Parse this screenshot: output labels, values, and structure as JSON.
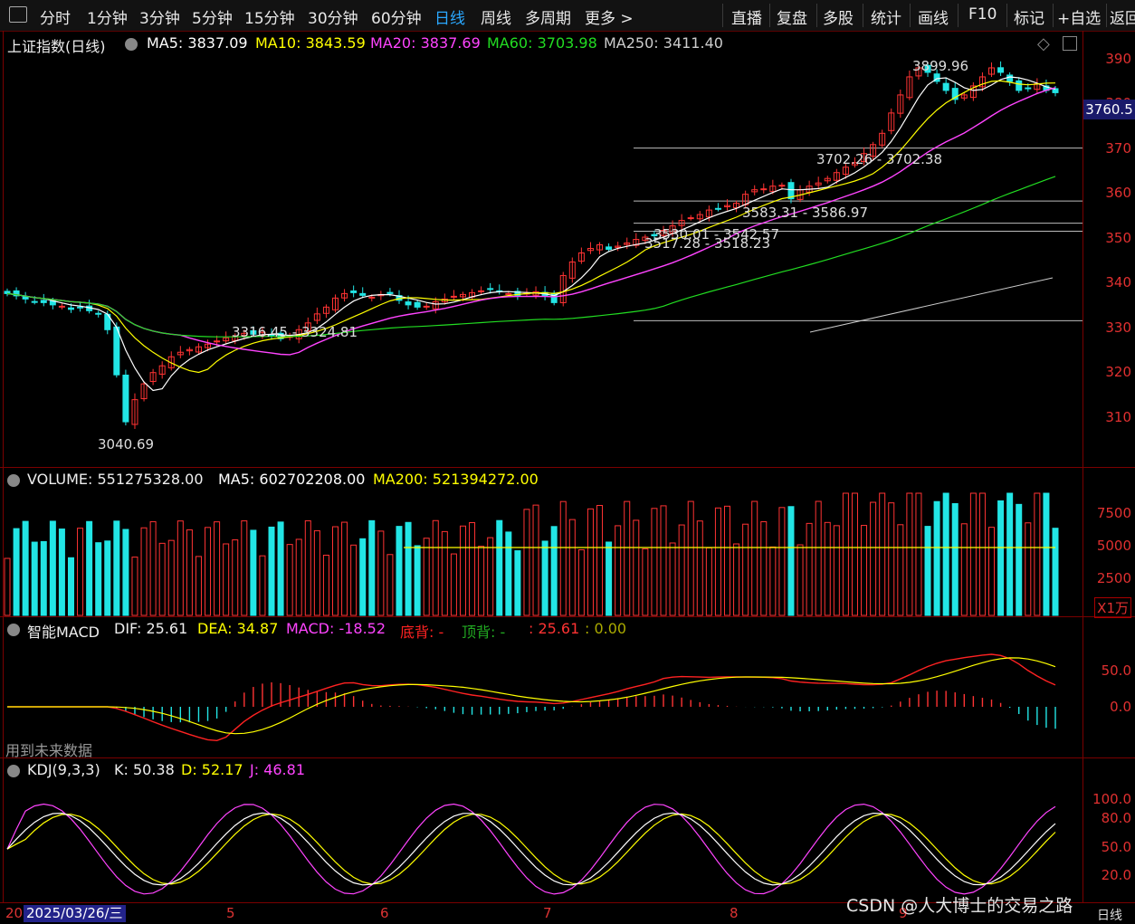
{
  "toolbar": {
    "periods": [
      "分时",
      "1分钟",
      "3分钟",
      "5分钟",
      "15分钟",
      "30分钟",
      "60分钟",
      "日线",
      "周线",
      "多周期",
      "更多 >"
    ],
    "active_period": "日线",
    "actions": [
      "直播",
      "复盘",
      "多股",
      "统计",
      "画线",
      "F10",
      "标记",
      "+自选",
      "返回"
    ]
  },
  "main": {
    "title": "上证指数(日线)",
    "ma": [
      {
        "label": "MA5: 3837.09",
        "color": "#ffffff"
      },
      {
        "label": "MA10: 3843.59",
        "color": "#ffff00"
      },
      {
        "label": "MA20: 3837.69",
        "color": "#ff44ff"
      },
      {
        "label": "MA60: 3703.98",
        "color": "#22dd22"
      },
      {
        "label": "MA250: 3411.40",
        "color": "#cccccc"
      }
    ],
    "last_price": "3760.5",
    "y_ticks": [
      "390",
      "380",
      "370",
      "360",
      "350",
      "340",
      "330",
      "320",
      "310"
    ],
    "annotations": [
      "3899.96",
      "3702.26 - 3702.38",
      "3583.31 - 3586.97",
      "3530.01 - 3542.57",
      "3517.28 - 3518.23",
      "3316.45 - 3324.81",
      "3040.69"
    ]
  },
  "volume": {
    "header": "VOLUME: 551275328.00",
    "ma5": "MA5: 602702208.00",
    "ma200": "MA200: 521394272.00",
    "y_ticks": [
      "7500",
      "5000",
      "2500"
    ],
    "unit": "X1万"
  },
  "macd": {
    "name": "智能MACD",
    "dif": "DIF: 25.61",
    "dea": "DEA: 34.87",
    "macd": "MACD: -18.52",
    "bottom_div": "底背: -",
    "top_div": "顶背: -",
    "v1": ": 25.61",
    "v2": ": 0.00",
    "y_ticks": [
      "50.0",
      "0.0"
    ],
    "note": "用到未来数据"
  },
  "kdj": {
    "name": "KDJ(9,3,3)",
    "k": "K: 50.38",
    "d": "D: 52.17",
    "j": "J: 46.81",
    "y_ticks": [
      "100.0",
      "80.0",
      "50.0",
      "20.0"
    ]
  },
  "datebar": {
    "current": "2025/03/26/三",
    "prefix": "20",
    "months": [
      "5",
      "6",
      "7",
      "8",
      "9"
    ],
    "period_label": "日线"
  },
  "watermark": "CSDN @人大博士的交易之路",
  "chart_data": {
    "type": "candlestick",
    "title": "上证指数(日线)",
    "ylim": [
      3000,
      3930
    ],
    "points": 116,
    "price_high_low_marks": {
      "high": 3899.96,
      "low": 3040.69
    },
    "close_approx": [
      3380,
      3375,
      3368,
      3362,
      3360,
      3355,
      3352,
      3345,
      3350,
      3342,
      3335,
      3300,
      3200,
      3096,
      3145,
      3180,
      3205,
      3220,
      3240,
      3250,
      3256,
      3262,
      3268,
      3275,
      3282,
      3286,
      3292,
      3290,
      3294,
      3288,
      3280,
      3285,
      3300,
      3315,
      3335,
      3350,
      3370,
      3380,
      3382,
      3376,
      3372,
      3378,
      3380,
      3365,
      3355,
      3350,
      3352,
      3362,
      3368,
      3374,
      3378,
      3382,
      3386,
      3390,
      3384,
      3380,
      3376,
      3382,
      3384,
      3375,
      3360,
      3420,
      3450,
      3470,
      3480,
      3488,
      3478,
      3485,
      3492,
      3500,
      3505,
      3508,
      3520,
      3530,
      3542,
      3548,
      3555,
      3565,
      3568,
      3575,
      3580,
      3600,
      3610,
      3612,
      3618,
      3620,
      3590,
      3610,
      3618,
      3625,
      3635,
      3648,
      3660,
      3670,
      3690,
      3710,
      3735,
      3780,
      3820,
      3860,
      3880,
      3870,
      3850,
      3830,
      3810,
      3820,
      3840,
      3860,
      3880,
      3870,
      3850,
      3830,
      3835,
      3845,
      3830,
      3825
    ],
    "ma_lines": {
      "MA5": "white",
      "MA10": "yellow",
      "MA20": "magenta",
      "MA60": "green",
      "MA250": "gray"
    },
    "volume_unit": "X1万",
    "macd": {
      "DIF": 25.61,
      "DEA": 34.87,
      "MACD": -18.52
    },
    "kdj": {
      "K": 50.38,
      "D": 52.17,
      "J": 46.81
    }
  }
}
